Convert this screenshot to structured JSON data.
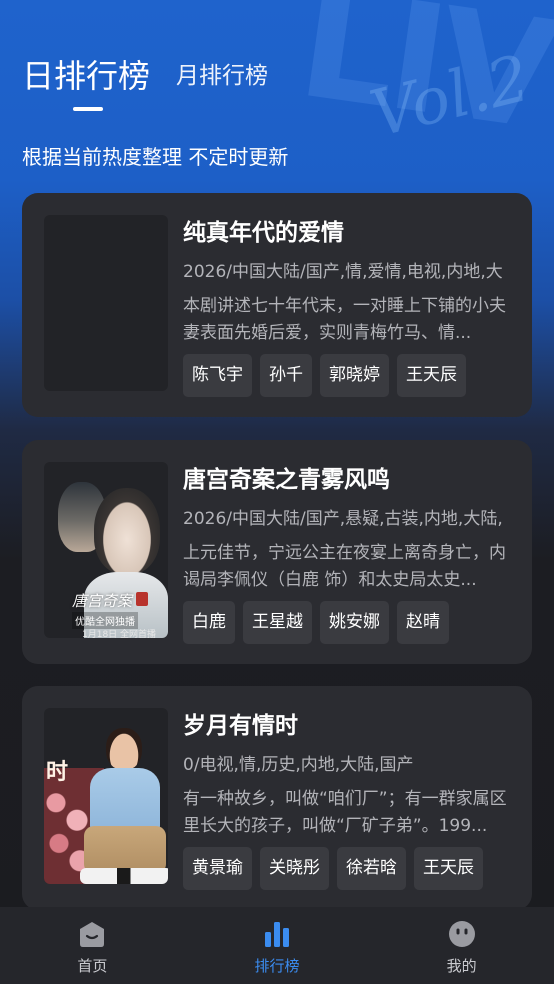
{
  "header": {
    "tabs": [
      {
        "label": "日排行榜",
        "active": true
      },
      {
        "label": "月排行榜",
        "active": false
      }
    ],
    "subtitle": "根据当前热度整理 不定时更新"
  },
  "ranking": [
    {
      "title": "纯真年代的爱情",
      "meta": "2026/中国大陆/国产,情,爱情,电视,内地,大",
      "description": "本剧讲述七十年代末，一对睡上下铺的小夫妻表面先婚后爱，实则青梅竹马、情...",
      "cast": [
        "陈飞宇",
        "孙千",
        "郭晓婷",
        "王天辰"
      ]
    },
    {
      "title": "唐宫奇案之青雾风鸣",
      "meta": "2026/中国大陆/国产,悬疑,古装,内地,大陆,",
      "description": "上元佳节，宁远公主在夜宴上离奇身亡，内谒局李佩仪（白鹿 饰）和太史局太史...",
      "cast": [
        "白鹿",
        "王星越",
        "姚安娜",
        "赵晴"
      ],
      "poster_text": {
        "title": "唐宫奇案",
        "badge": "优酷全网独播",
        "date": "1月18日 全网首播"
      }
    },
    {
      "title": "岁月有情时",
      "meta": "0/电视,情,历史,内地,大陆,国产",
      "description": "有一种故乡，叫做“咱们厂”；有一群家属区里长大的孩子，叫做“厂矿子弟”。199...",
      "cast": [
        "黄景瑜",
        "关晓彤",
        "徐若晗",
        "王天辰"
      ],
      "poster_text": {
        "title": "时"
      }
    }
  ],
  "bottom_nav": [
    {
      "label": "首页",
      "icon": "home-icon",
      "active": false
    },
    {
      "label": "排行榜",
      "icon": "ranking-bars-icon",
      "active": true
    },
    {
      "label": "我的",
      "icon": "profile-face-icon",
      "active": false
    }
  ],
  "colors": {
    "accent": "#3b8cf0",
    "card_bg": "#2b2c31",
    "tag_bg": "#3a3b40",
    "header_blue": "#1f63cc"
  }
}
